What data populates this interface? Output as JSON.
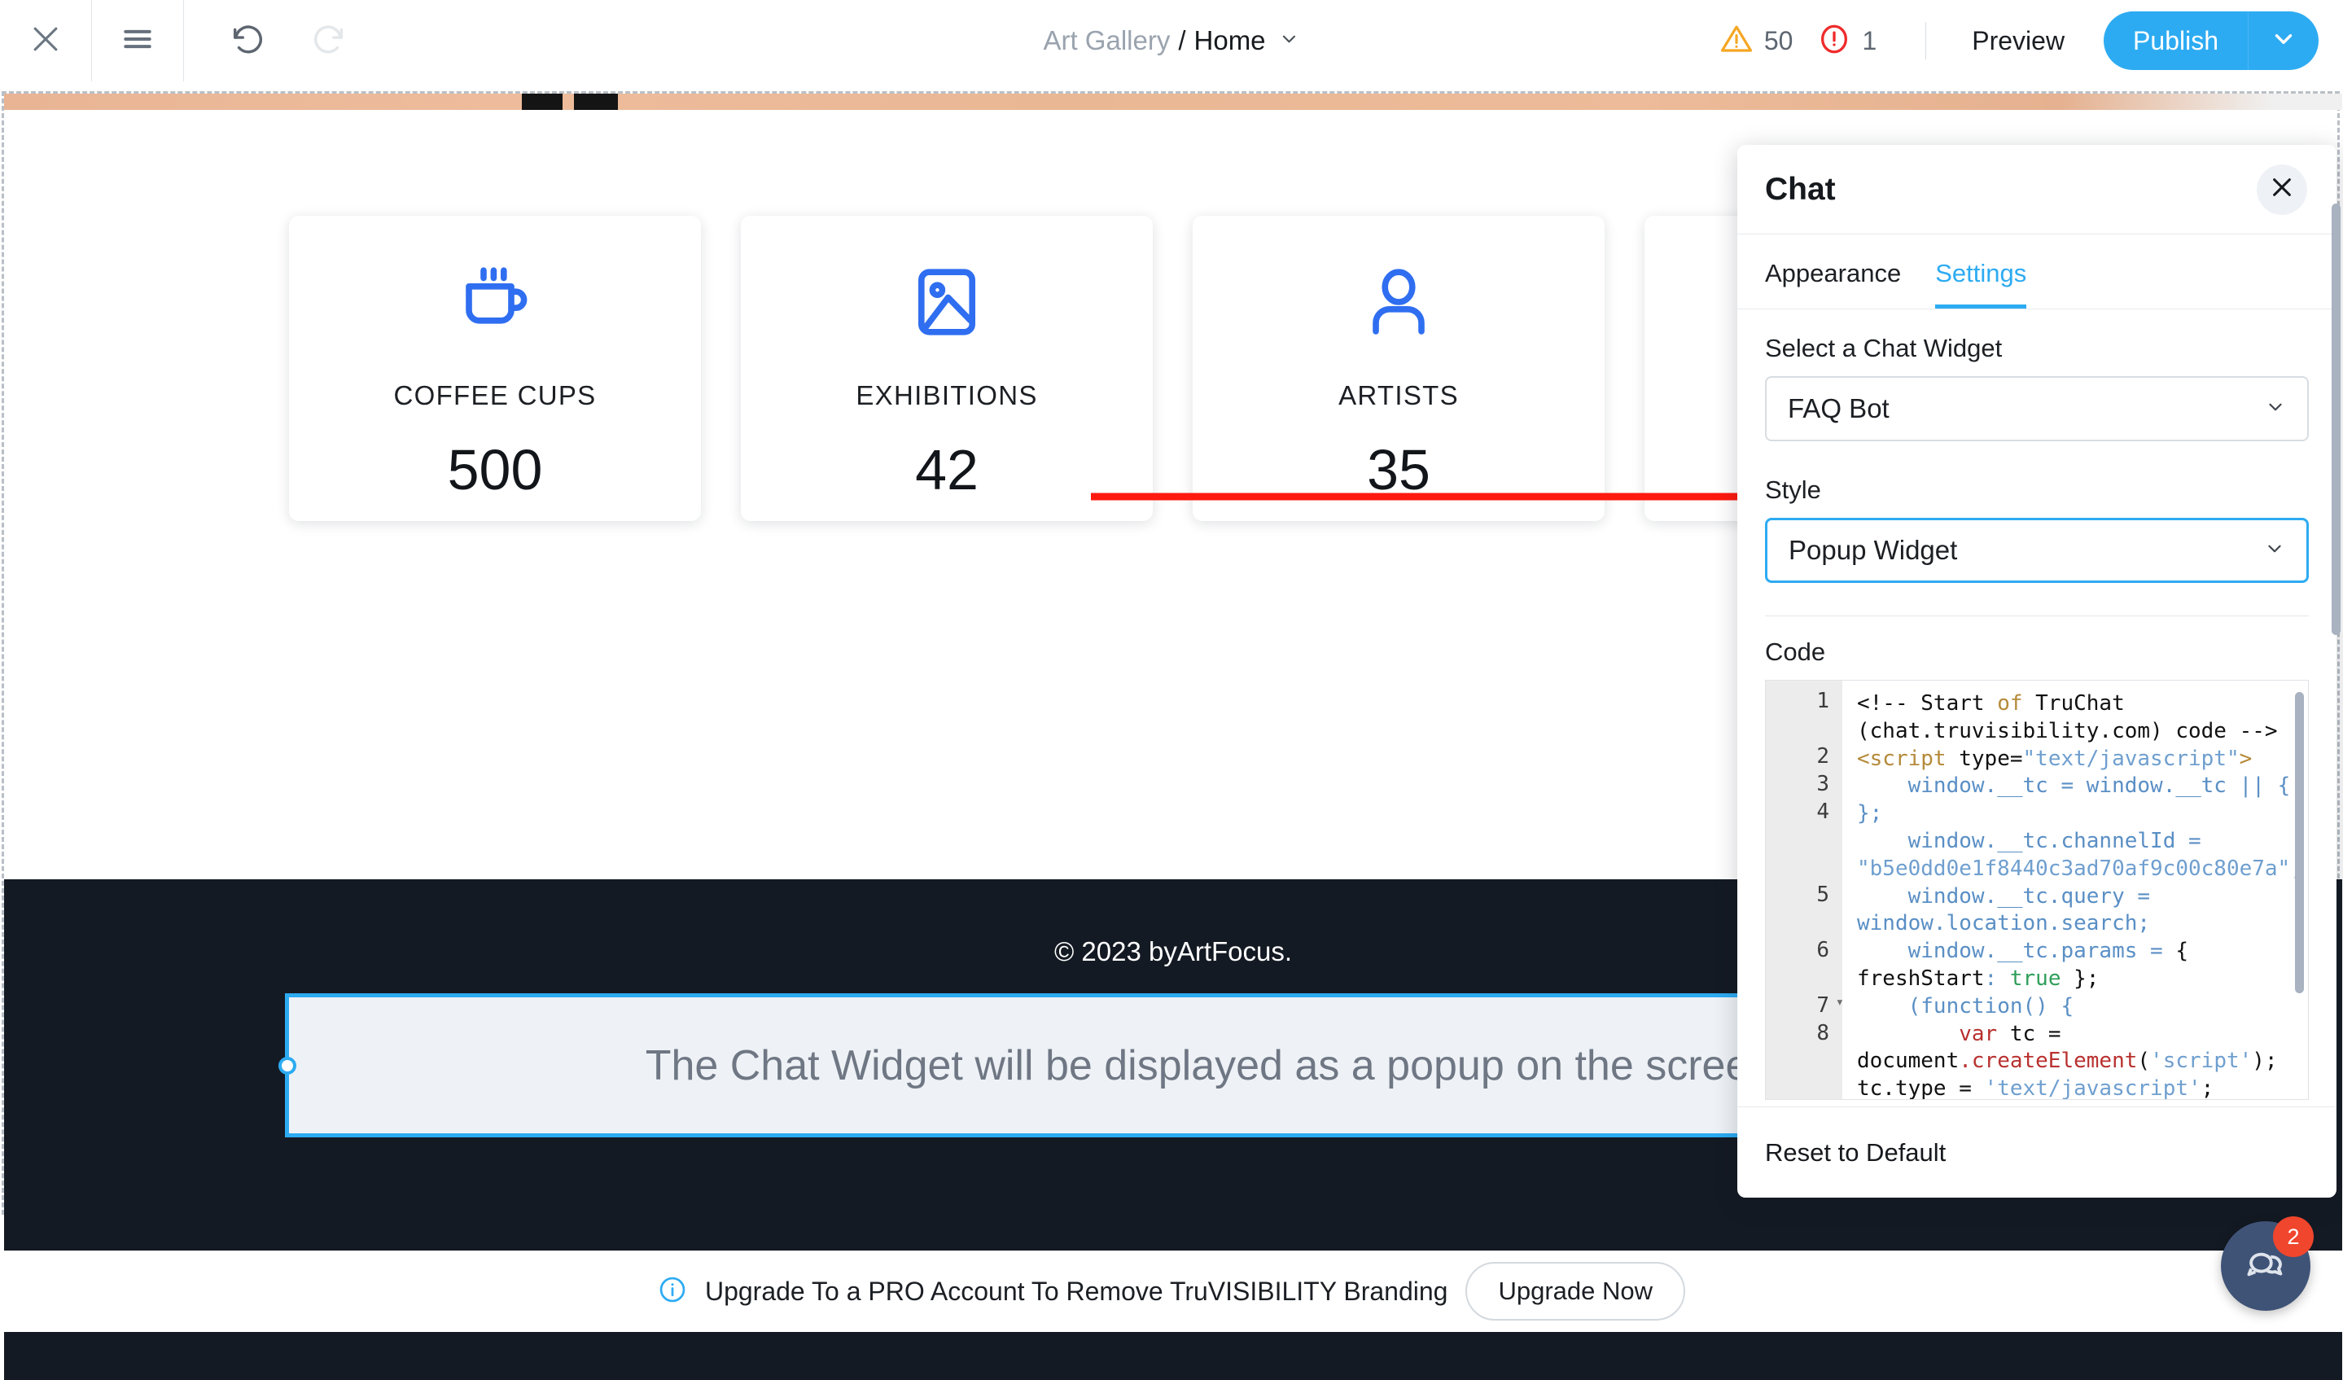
{
  "toolbar": {
    "close_icon": "close-icon",
    "menu_icon": "hamburger-menu-icon",
    "undo_icon": "undo-icon",
    "redo_icon": "redo-icon",
    "breadcrumb": {
      "site": "Art Gallery",
      "separator": "/",
      "page": "Home",
      "chevron": "chevron-down-icon"
    },
    "warnings_count": "50",
    "errors_count": "1",
    "preview_label": "Preview",
    "publish_label": "Publish",
    "publish_caret": "chevron-down-icon",
    "accent_color": "#2dabf2",
    "warning_color": "#f5a623",
    "error_color": "#ef2b2b"
  },
  "canvas": {
    "cards": [
      {
        "icon": "coffee-cup-icon",
        "label": "COFFEE CUPS",
        "value": "500"
      },
      {
        "icon": "image-icon",
        "label": "EXHIBITIONS",
        "value": "42"
      },
      {
        "icon": "person-icon",
        "label": "ARTISTS",
        "value": "35"
      },
      {
        "icon": "partial-icon",
        "label": "",
        "value": ""
      }
    ],
    "card_icon_color": "#2f6ef0",
    "footer_copyright": "© 2023 byArtFocus.",
    "widget_placeholder": "The Chat Widget will be displayed as a popup on the screen",
    "dark_band_color": "#141a23",
    "selection_color": "#2dabf2",
    "annotation_arrow_color": "#ff1a0f"
  },
  "chat_panel": {
    "title": "Chat",
    "close_icon": "close-icon",
    "tabs": [
      {
        "label": "Appearance",
        "active": false
      },
      {
        "label": "Settings",
        "active": true
      }
    ],
    "widget_field": {
      "label": "Select a Chat Widget",
      "value": "FAQ Bot",
      "chevron": "chevron-down-icon"
    },
    "style_field": {
      "label": "Style",
      "value": "Popup Widget",
      "chevron": "chevron-down-icon",
      "focused": true
    },
    "code_label": "Code",
    "code_lines": [
      {
        "num": "1",
        "fold": false
      },
      {
        "num": "",
        "fold": false
      },
      {
        "num": "2",
        "fold": false
      },
      {
        "num": "3",
        "fold": false
      },
      {
        "num": "4",
        "fold": false
      },
      {
        "num": "",
        "fold": false
      },
      {
        "num": "",
        "fold": false
      },
      {
        "num": "5",
        "fold": false
      },
      {
        "num": "",
        "fold": false
      },
      {
        "num": "6",
        "fold": false
      },
      {
        "num": "",
        "fold": false
      },
      {
        "num": "7",
        "fold": true
      },
      {
        "num": "8",
        "fold": false
      },
      {
        "num": "",
        "fold": false
      },
      {
        "num": "",
        "fold": false
      },
      {
        "num": "",
        "fold": false
      }
    ],
    "code_text": "<!-- Start of TruChat (chat.truvisibility.com) code -->\n<script type=\"text/javascript\">\n    window.__tc = window.__tc || { };\n    window.__tc.channelId = \"b5e0dd0e1f8440c3ad70af9c00c80e7a\";\n    window.__tc.query = window.location.search;\n    window.__tc.params = { freshStart: true };\n    (function() {\n        var tc = document.createElement('script'); tc.type = 'text/javascript'; tc.async =",
    "reset_label": "Reset to Default"
  },
  "bottom_bar": {
    "info_icon": "info-icon",
    "message": "Upgrade To a PRO Account To Remove TruVISIBILITY Branding",
    "upgrade_label": "Upgrade Now"
  },
  "chat_fab": {
    "icon": "chat-bubbles-icon",
    "badge": "2",
    "color": "#3f5377",
    "badge_color": "#f0462d"
  }
}
